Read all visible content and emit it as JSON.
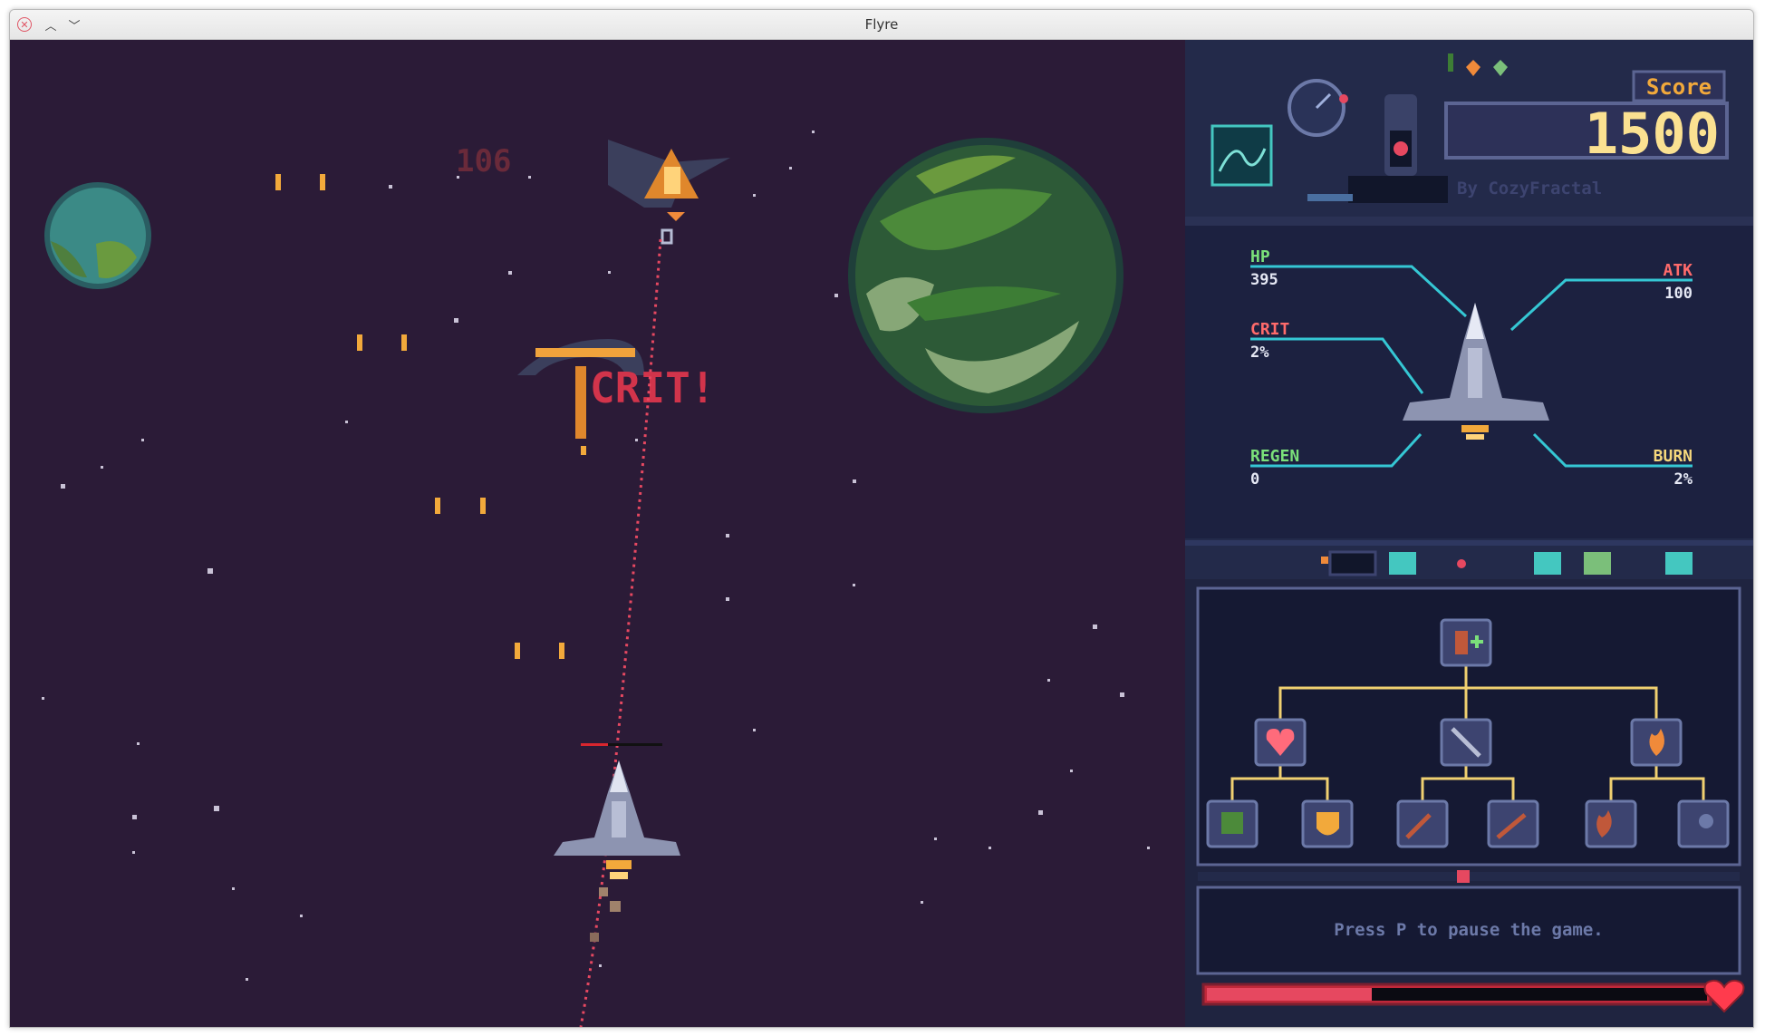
{
  "window": {
    "title": "Flyre"
  },
  "game": {
    "damage_number": "106",
    "crit_text": "CRIT!"
  },
  "hud": {
    "score_label": "Score",
    "score_value": "1500",
    "credit": "By CozyFractal",
    "stats": {
      "hp": {
        "label": "HP",
        "value": "395"
      },
      "atk": {
        "label": "ATK",
        "value": "100"
      },
      "crit": {
        "label": "CRIT",
        "value": "2%"
      },
      "regen": {
        "label": "REGEN",
        "value": "0"
      },
      "burn": {
        "label": "BURN",
        "value": "2%"
      }
    },
    "message": "Press P to pause the game.",
    "health_fraction": 0.33
  },
  "colors": {
    "space": "#2b1b37",
    "hud_bg": "#1f2440",
    "stat_green": "#7be07a",
    "stat_red": "#ff6b6b",
    "stat_yellow": "#f5d77c",
    "line_cyan": "#35c7d4",
    "tree_line": "#f0d070",
    "health_red": "#d8262e"
  }
}
